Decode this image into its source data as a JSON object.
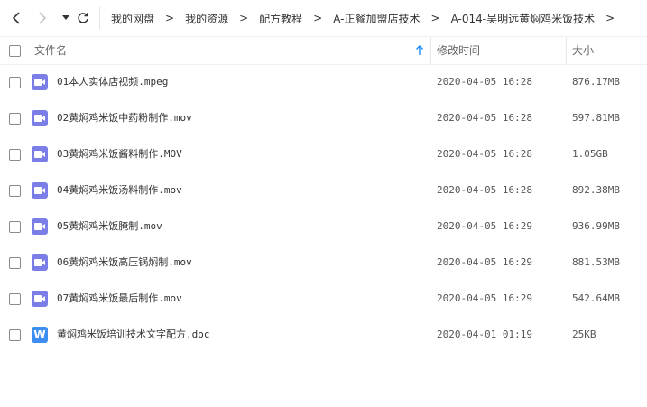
{
  "nav": {
    "back_icon": "chevron-left-icon",
    "forward_icon": "chevron-right-icon",
    "dropdown_icon": "caret-down-icon",
    "refresh_icon": "refresh-icon"
  },
  "breadcrumb": {
    "items": [
      "我的网盘",
      "我的资源",
      "配方教程",
      "A-正餐加盟店技术",
      "A-014-吴明远黄焖鸡米饭技术"
    ],
    "separator": ">"
  },
  "table": {
    "columns": {
      "name": "文件名",
      "modified": "修改时间",
      "size": "大小"
    },
    "sort_icon": "sort-ascending-icon",
    "accent_color": "#1a8cff",
    "rows": [
      {
        "type": "video",
        "name": "01本人实体店视频.mpeg",
        "modified": "2020-04-05 16:28",
        "size": "876.17MB"
      },
      {
        "type": "video",
        "name": "02黄焖鸡米饭中药粉制作.mov",
        "modified": "2020-04-05 16:28",
        "size": "597.81MB"
      },
      {
        "type": "video",
        "name": "03黄焖鸡米饭酱料制作.MOV",
        "modified": "2020-04-05 16:28",
        "size": "1.05GB"
      },
      {
        "type": "video",
        "name": "04黄焖鸡米饭汤料制作.mov",
        "modified": "2020-04-05 16:28",
        "size": "892.38MB"
      },
      {
        "type": "video",
        "name": "05黄焖鸡米饭腌制.mov",
        "modified": "2020-04-05 16:29",
        "size": "936.99MB"
      },
      {
        "type": "video",
        "name": "06黄焖鸡米饭高压锅焖制.mov",
        "modified": "2020-04-05 16:29",
        "size": "881.53MB"
      },
      {
        "type": "video",
        "name": "07黄焖鸡米饭最后制作.mov",
        "modified": "2020-04-05 16:29",
        "size": "542.64MB"
      },
      {
        "type": "doc",
        "icon_letter": "W",
        "name": "黄焖鸡米饭培训技术文字配方.doc",
        "modified": "2020-04-01 01:19",
        "size": "25KB"
      }
    ]
  },
  "colors": {
    "video_icon": "#7b7ee6",
    "doc_icon": "#3d8ef0"
  }
}
